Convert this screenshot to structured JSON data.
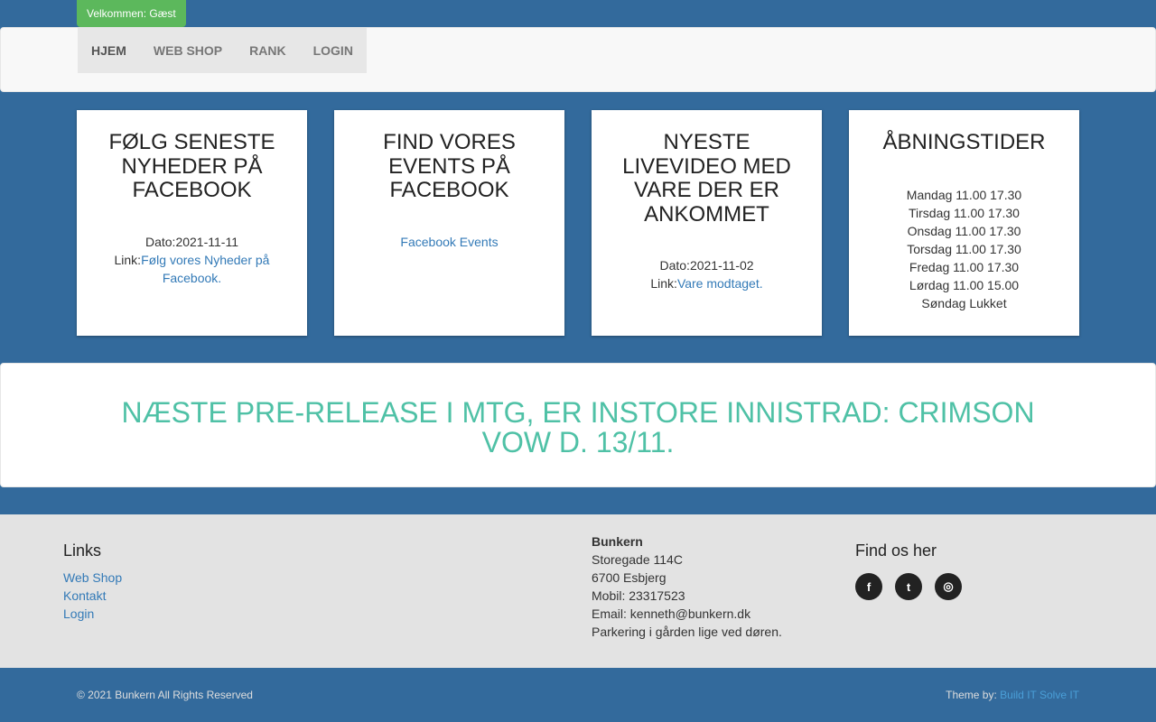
{
  "welcome": "Velkommen: Gæst",
  "nav": [
    {
      "label": "HJEM"
    },
    {
      "label": "WEB SHOP"
    },
    {
      "label": "RANK"
    },
    {
      "label": "LOGIN"
    }
  ],
  "cards": [
    {
      "title": "FØLG SENESTE NYHEDER PÅ FACEBOOK",
      "date_label": "Dato:",
      "date": "2021-11-11",
      "link_label": "Link:",
      "link_text": "Følg vores Nyheder på Facebook."
    },
    {
      "title": "FIND VORES EVENTS PÅ FACEBOOK",
      "link_text": "Facebook Events"
    },
    {
      "title": "NYESTE LIVEVIDEO MED VARE DER ER ANKOMMET",
      "date_label": "Dato:",
      "date": "2021-11-02",
      "link_label": "Link:",
      "link_text": "Vare modtaget."
    },
    {
      "title": "ÅBNINGSTIDER",
      "hours": [
        "Mandag 11.00 17.30",
        "Tirsdag 11.00 17.30",
        "Onsdag 11.00 17.30",
        "Torsdag 11.00 17.30",
        "Fredag 11.00 17.30",
        "Lørdag 11.00 15.00",
        "Søndag Lukket"
      ]
    }
  ],
  "banner": "NÆSTE PRE-RELEASE I MTG, ER INSTORE INNISTRAD: CRIMSON VOW D. 13/11.",
  "footer": {
    "links_title": "Links",
    "links": [
      "Web Shop",
      "Kontakt",
      "Login"
    ],
    "address": {
      "name": "Bunkern",
      "street": "Storegade 114C",
      "city": "6700 Esbjerg",
      "phone": "Mobil: 23317523",
      "email": "Email: kenneth@bunkern.dk",
      "parking": "Parkering i gården lige ved døren."
    },
    "find_title": "Find os her",
    "social": [
      {
        "icon": "facebook-icon",
        "glyph": "f"
      },
      {
        "icon": "twitter-icon",
        "glyph": "t"
      },
      {
        "icon": "instagram-icon",
        "glyph": "◎"
      }
    ]
  },
  "bottom": {
    "copyright": "© 2021 Bunkern All Rights Reserved",
    "theme_label": "Theme by:",
    "theme_link": "Build IT Solve IT"
  },
  "colors": {
    "background": "#336a9c",
    "accent": "#4fc1a6",
    "welcome_badge": "#5cb85c",
    "link": "#337ab7"
  }
}
